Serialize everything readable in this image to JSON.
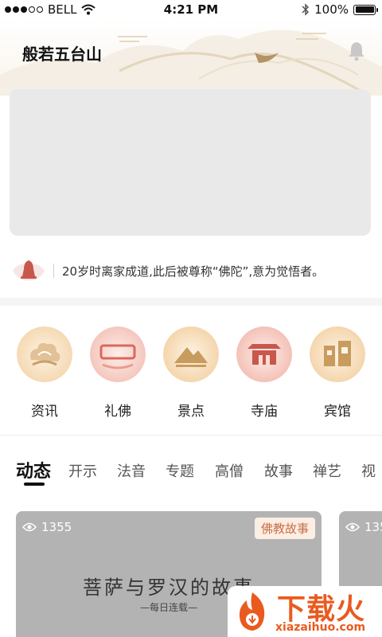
{
  "status_bar": {
    "carrier": "BELL",
    "time": "4:21 PM",
    "battery": "100%",
    "battery_level": 1.0
  },
  "header": {
    "title": "般若五台山"
  },
  "notice": {
    "text": "20岁时离家成道,此后被尊称“佛陀”,意为觉悟者。"
  },
  "categories": [
    {
      "label": "资讯",
      "icon": "cloud-lotus-icon"
    },
    {
      "label": "礼佛",
      "icon": "wutaishan-text-icon"
    },
    {
      "label": "景点",
      "icon": "mountain-icon"
    },
    {
      "label": "寺庙",
      "icon": "temple-icon"
    },
    {
      "label": "宾馆",
      "icon": "hotel-icon"
    }
  ],
  "tabs": [
    "动态",
    "开示",
    "法音",
    "专题",
    "高僧",
    "故事",
    "禅艺",
    "视"
  ],
  "card": {
    "views": "1355",
    "badge": "佛教故事",
    "title": "菩萨与罗汉的故事",
    "subtitle": "—每日连载—"
  },
  "card2": {
    "views": "135"
  },
  "watermark": {
    "text": "下载火",
    "url": "xiazaihuo.com"
  },
  "colors": {
    "accent": "#c86f4a",
    "gold": "#d7b98c",
    "watermark": "#ea5a1f"
  }
}
